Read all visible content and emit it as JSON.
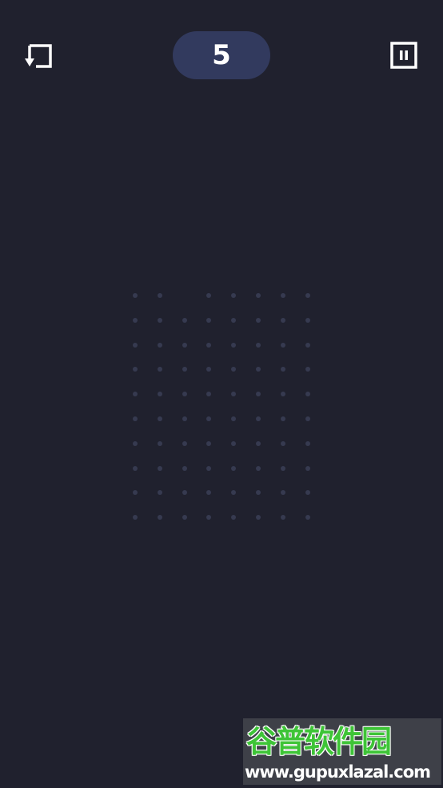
{
  "header": {
    "level": "5",
    "undo_icon": "undo-icon",
    "pause_icon": "pause-icon"
  },
  "board": {
    "cols": 8,
    "rows": 10,
    "missing_cells": [
      [
        0,
        2
      ]
    ],
    "dot_color": "#363a50"
  },
  "watermark": {
    "title": "谷普软件园",
    "url": "www.gupuxlazal.com"
  },
  "colors": {
    "background": "#20212e",
    "pill": "#323a5e",
    "icon": "#ffffff",
    "watermark_green": "#3ec437"
  }
}
